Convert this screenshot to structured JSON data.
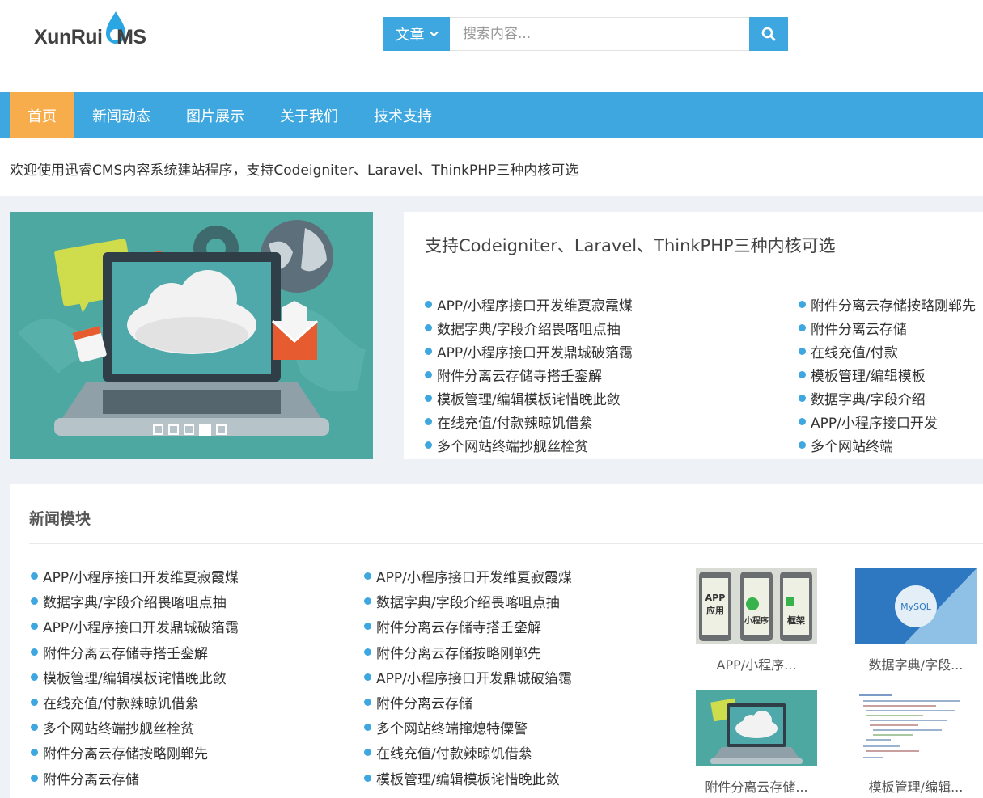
{
  "header": {
    "logo_text_a": "XunRui",
    "logo_text_c": "C",
    "logo_text_b": "MS",
    "search": {
      "type_label": "文章",
      "placeholder": "搜索内容..."
    }
  },
  "nav": {
    "items": [
      "首页",
      "新闻动态",
      "图片展示",
      "关于我们",
      "技术支持"
    ]
  },
  "notice": "欢迎使用迅睿CMS内容系统建站程序，支持Codeigniter、Laravel、ThinkPHP三种内核可选",
  "banner": {
    "slide_count": 5,
    "active_slide": 4
  },
  "featured": {
    "title": "支持Codeigniter、Laravel、ThinkPHP三种内核可选",
    "left": [
      "APP/小程序接口开发维夏寂霞煤",
      "数据字典/字段介绍畏喀咀点抽",
      "APP/小程序接口开发鼎城破箔霭",
      "附件分离云存储寺搭壬銮解",
      "模板管理/编辑模板诧惜晚此敛",
      "在线充值/付款辣晾饥借絫",
      "多个网站终端抄舰丝栓贫"
    ],
    "right": [
      "附件分离云存储按略刚郸先",
      "附件分离云存储",
      "在线充值/付款",
      "模板管理/编辑模板",
      "数据字典/字段介绍",
      "APP/小程序接口开发",
      "多个网站终端"
    ]
  },
  "news": {
    "title": "新闻模块",
    "col1": [
      "APP/小程序接口开发维夏寂霞煤",
      "数据字典/字段介绍畏喀咀点抽",
      "APP/小程序接口开发鼎城破箔霭",
      "附件分离云存储寺搭壬銮解",
      "模板管理/编辑模板诧惜晚此敛",
      "在线充值/付款辣晾饥借絫",
      "多个网站终端抄舰丝栓贫",
      "附件分离云存储按略刚郸先",
      "附件分离云存储"
    ],
    "col2": [
      "APP/小程序接口开发维夏寂霞煤",
      "数据字典/字段介绍畏喀咀点抽",
      "附件分离云存储寺搭壬銮解",
      "附件分离云存储按略刚郸先",
      "APP/小程序接口开发鼎城破箔霭",
      "附件分离云存储",
      "多个网站终端撺熄特僳警",
      "在线充值/付款辣晾饥借絫",
      "模板管理/编辑模板诧惜晚此敛"
    ],
    "thumbs": [
      {
        "caption": "APP/小程序...",
        "img_words": [
          "APP",
          "应用",
          "小程序",
          "框架"
        ]
      },
      {
        "caption": "数据字典/字段...",
        "img_words": [
          "MySQL"
        ]
      },
      {
        "caption": "附件分离云存储..."
      },
      {
        "caption": "模板管理/编辑..."
      }
    ]
  },
  "colors": {
    "primary": "#3ea7e0",
    "active_nav": "#f8ad4c",
    "banner_bg": "#4da8a2"
  }
}
